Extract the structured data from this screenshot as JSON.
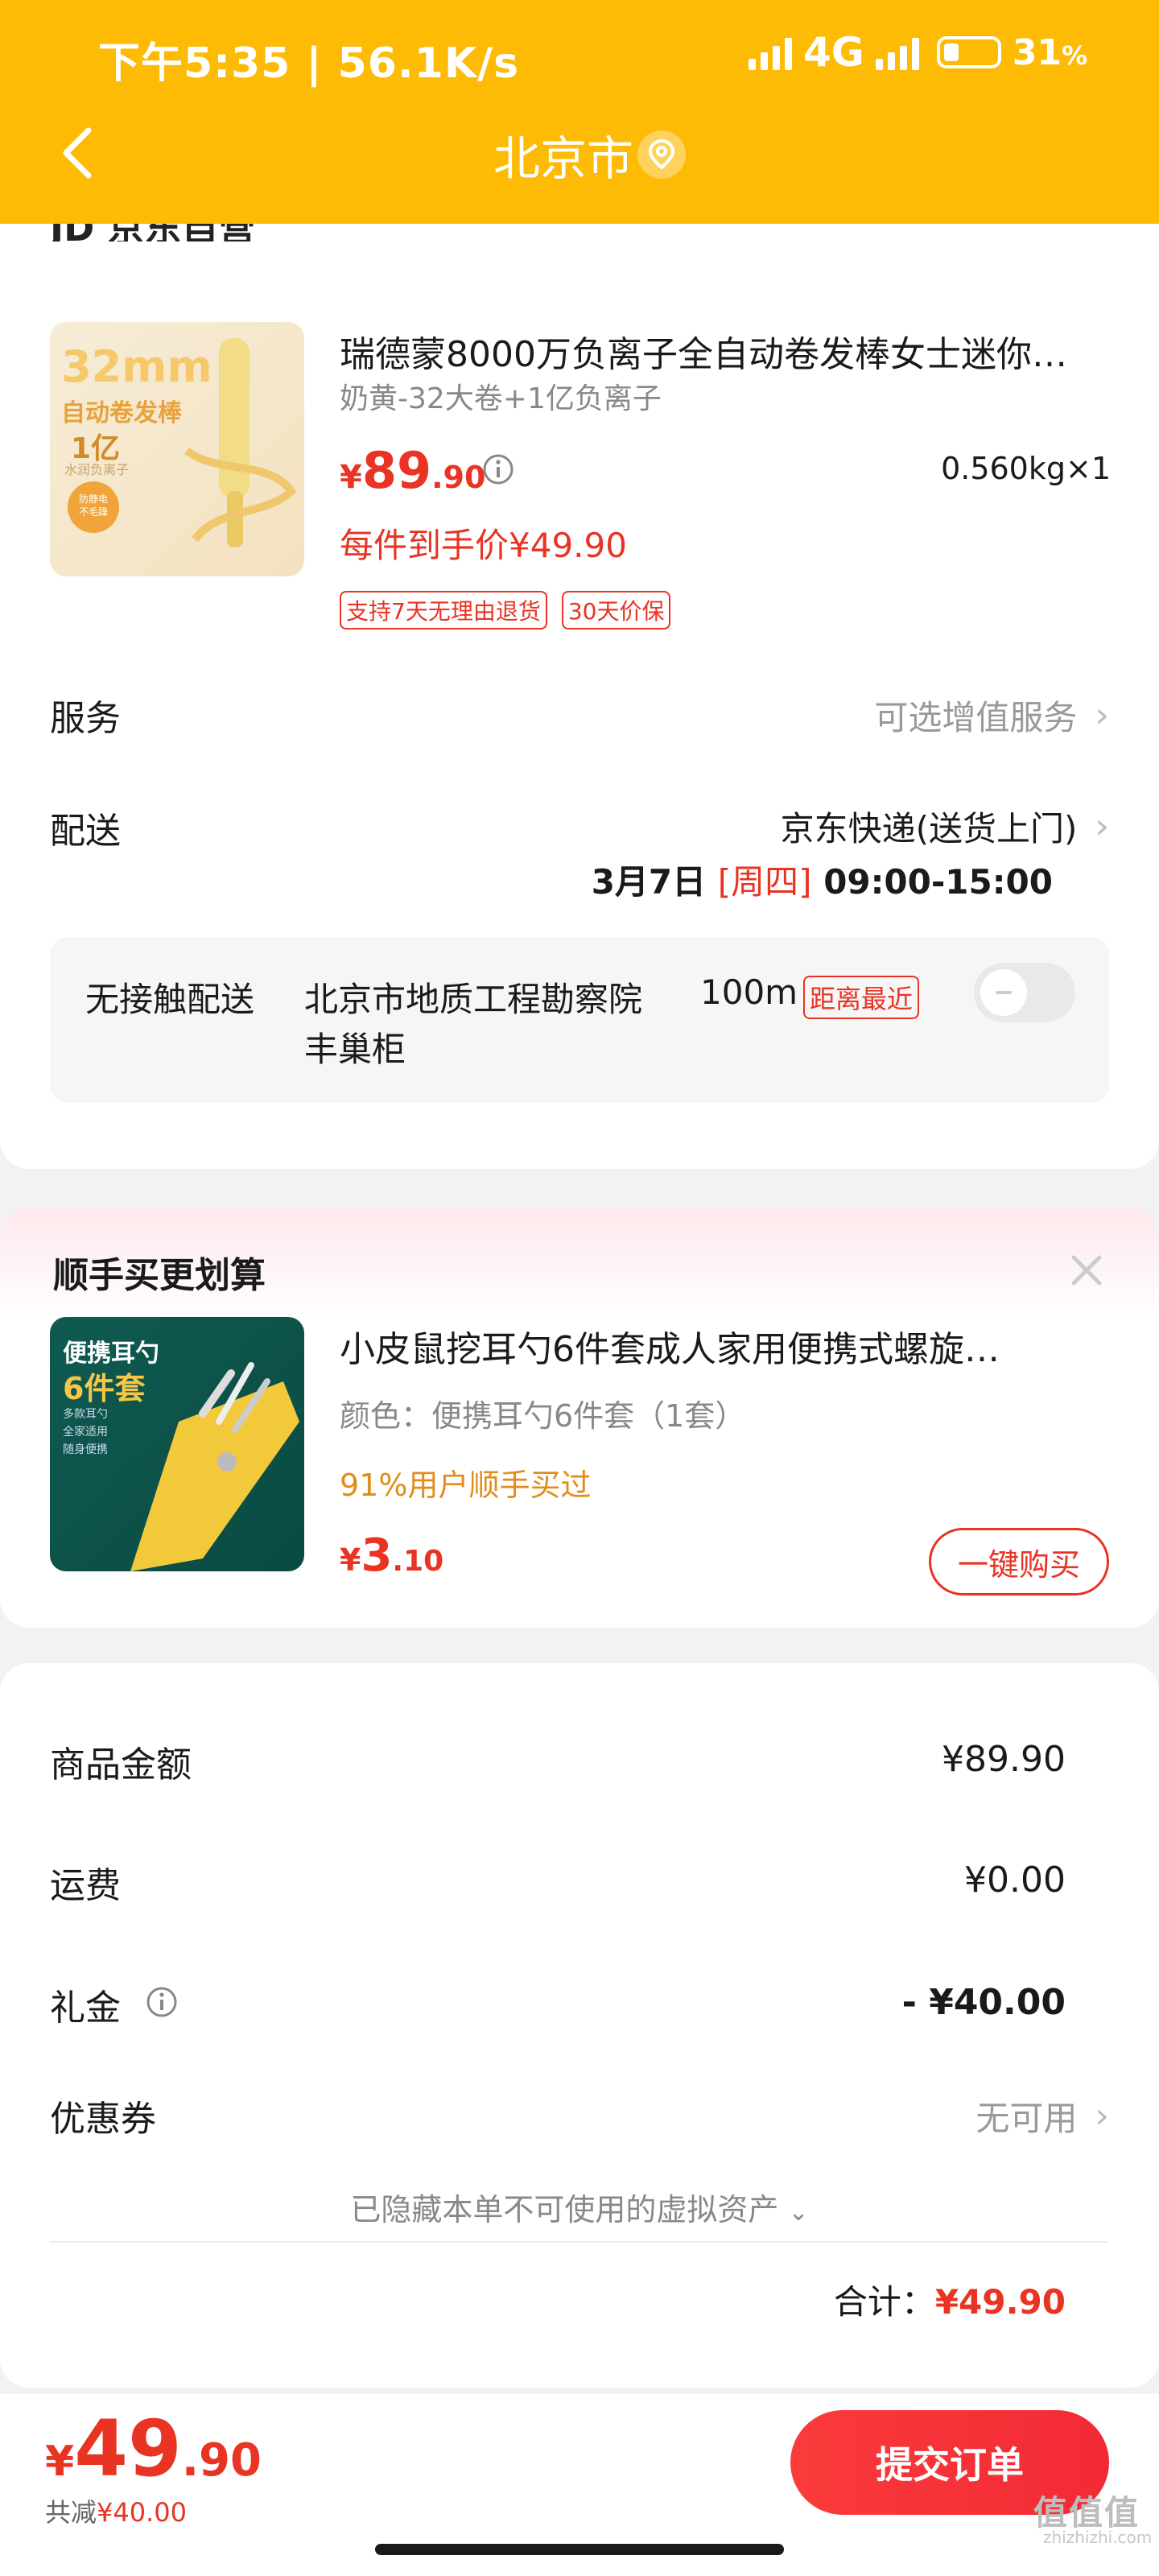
{
  "status_bar": {
    "time": "下午5:35 | 56.1K/s",
    "network": "4G",
    "battery": "31",
    "battery_unit": "%"
  },
  "header": {
    "title": "北京市",
    "back_icon": "chevron-left-icon",
    "location_icon": "location-pin-icon",
    "bg_color": "#fdbb06"
  },
  "shop": {
    "name_partial": "JD 京东自营"
  },
  "product": {
    "title": "瑞德蒙8000万负离子全自动卷发棒女士迷你…",
    "spec": "奶黄-32大卷+1亿负离子",
    "price_symbol": "¥",
    "price_int": "89",
    "price_dec": ".90",
    "weight_qty": "0.560kg×1",
    "final_price_text": "每件到手价¥49.90",
    "tags": [
      "支持7天无理由退货",
      "30天价保"
    ],
    "thumb_text": [
      "32mm",
      "自动卷发棒",
      "1亿",
      "水润负离子",
      "防静电",
      "不毛躁"
    ]
  },
  "service": {
    "label": "服务",
    "value": "可选增值服务"
  },
  "delivery": {
    "label": "配送",
    "method": "京东快递(送货上门)",
    "date": "3月7日",
    "weekday": "[周四]",
    "time_range": "09:00-15:00"
  },
  "contactless": {
    "label": "无接触配送",
    "location_line1": "北京市地质工程勘察院",
    "location_line2": "丰巢柜",
    "distance": "100m",
    "badge": "距离最近"
  },
  "addon": {
    "section_title": "顺手买更划算",
    "title": "小皮鼠挖耳勺6件套成人家用便携式螺旋…",
    "spec": "颜色：便携耳勺6件套（1套）",
    "popularity": "91%用户顺手买过",
    "price_symbol": "¥",
    "price_int": "3",
    "price_dec": ".10",
    "buy_label": "一键购买",
    "thumb_text": [
      "便携耳勺",
      "6件套",
      "多款耳勺",
      "全家适用",
      "随身便携"
    ]
  },
  "summary": {
    "goods_label": "商品金额",
    "goods_value": "¥89.90",
    "shipping_label": "运费",
    "shipping_value": "¥0.00",
    "gift_label": "礼金",
    "gift_value": "- ¥40.00",
    "coupon_label": "优惠券",
    "coupon_value": "无可用",
    "hidden_assets": "已隐藏本单不可使用的虚拟资产",
    "total_label": "合计：",
    "total_value": "¥49.90"
  },
  "bottom": {
    "price_symbol": "¥",
    "price_int": "49",
    "price_dec": ".90",
    "discount_label": "共减",
    "discount_value": "¥40.00",
    "submit_label": "提交订单"
  },
  "watermark": {
    "text": "值值值",
    "sub": "zhizhizhi.com"
  }
}
